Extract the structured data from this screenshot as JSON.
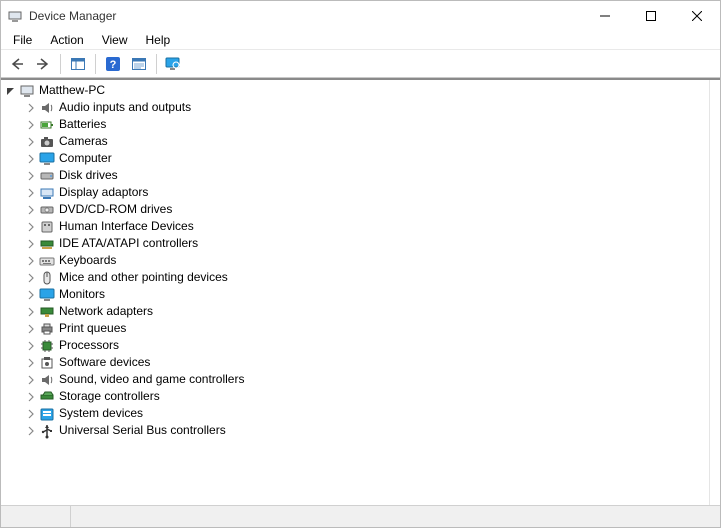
{
  "window": {
    "title": "Device Manager"
  },
  "menubar": {
    "items": [
      "File",
      "Action",
      "View",
      "Help"
    ]
  },
  "tree": {
    "root": {
      "label": "Matthew-PC",
      "icon": "computer-icon",
      "expanded": true
    },
    "children": [
      {
        "label": "Audio inputs and outputs",
        "icon": "audio-icon"
      },
      {
        "label": "Batteries",
        "icon": "battery-icon"
      },
      {
        "label": "Cameras",
        "icon": "camera-icon"
      },
      {
        "label": "Computer",
        "icon": "monitor-icon"
      },
      {
        "label": "Disk drives",
        "icon": "disk-icon"
      },
      {
        "label": "Display adaptors",
        "icon": "display-adapter-icon"
      },
      {
        "label": "DVD/CD-ROM drives",
        "icon": "optical-drive-icon"
      },
      {
        "label": "Human Interface Devices",
        "icon": "hid-icon"
      },
      {
        "label": "IDE ATA/ATAPI controllers",
        "icon": "ide-icon"
      },
      {
        "label": "Keyboards",
        "icon": "keyboard-icon"
      },
      {
        "label": "Mice and other pointing devices",
        "icon": "mouse-icon"
      },
      {
        "label": "Monitors",
        "icon": "monitor-icon"
      },
      {
        "label": "Network adapters",
        "icon": "network-icon"
      },
      {
        "label": "Print queues",
        "icon": "printer-icon"
      },
      {
        "label": "Processors",
        "icon": "processor-icon"
      },
      {
        "label": "Software devices",
        "icon": "software-icon"
      },
      {
        "label": "Sound, video and game controllers",
        "icon": "audio-icon"
      },
      {
        "label": "Storage controllers",
        "icon": "storage-icon"
      },
      {
        "label": "System devices",
        "icon": "system-icon"
      },
      {
        "label": "Universal Serial Bus controllers",
        "icon": "usb-icon"
      }
    ]
  }
}
